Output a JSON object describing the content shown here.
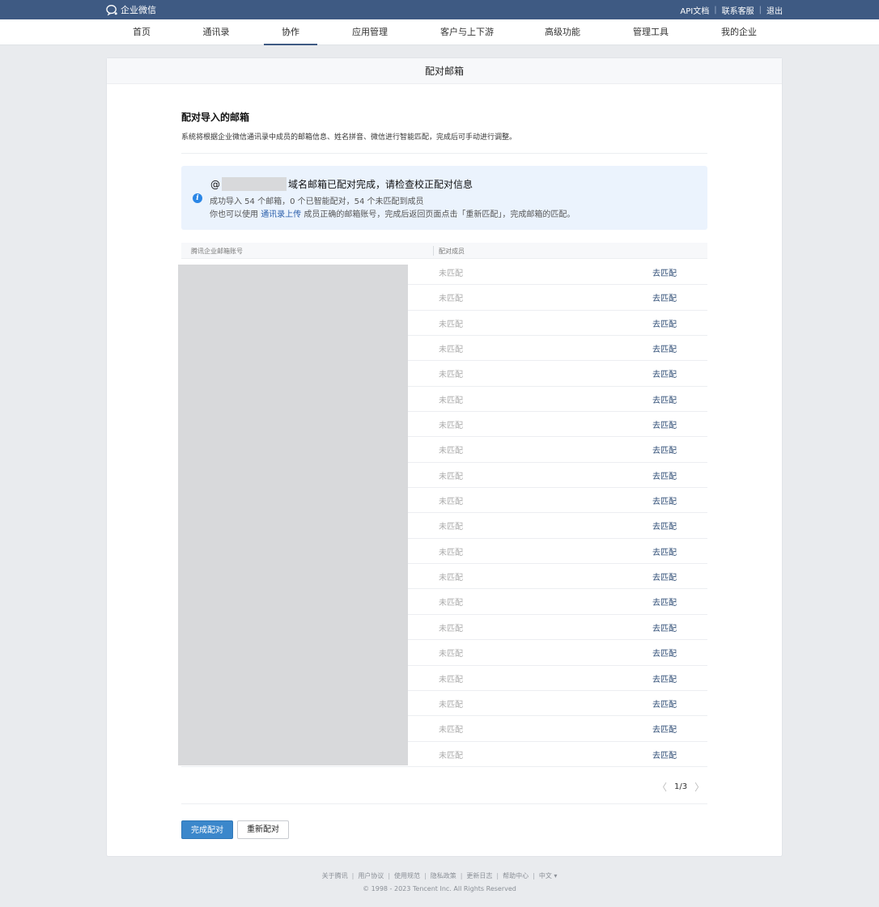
{
  "topbar": {
    "brand": "企业微信",
    "links": [
      "API文档",
      "联系客服",
      "退出"
    ]
  },
  "nav": {
    "items": [
      {
        "label": "首页"
      },
      {
        "label": "通讯录"
      },
      {
        "label": "协作",
        "active": true
      },
      {
        "label": "应用管理"
      },
      {
        "label": "客户与上下游"
      },
      {
        "label": "高级功能"
      },
      {
        "label": "管理工具"
      },
      {
        "label": "我的企业"
      }
    ]
  },
  "card": {
    "header": "配对邮箱",
    "section_title": "配对导入的邮箱",
    "section_desc": "系统将根据企业微信通讯录中成员的邮箱信息、姓名拼音、微信进行智能匹配，完成后可手动进行调整。"
  },
  "notice": {
    "at_prefix": "@",
    "title": "域名邮箱已配对完成，请检查校正配对信息",
    "line1": "成功导入 54 个邮箱，0 个已智能配对，54 个未匹配到成员",
    "line2_prefix": "你也可以使用",
    "line2_link": "通讯录上传",
    "line2_suffix": "成员正确的邮箱账号，完成后返回页面点击「重新匹配」，完成邮箱的匹配。"
  },
  "table": {
    "col1": "腾讯企业邮箱账号",
    "col2": "配对成员",
    "row_status": "未匹配",
    "row_action": "去匹配",
    "row_count": 20
  },
  "pager": {
    "page": "1/3",
    "prev": "〈",
    "next": "〉"
  },
  "buttons": {
    "finish": "完成配对",
    "rematch": "重新配对"
  },
  "footer": {
    "links": [
      "关于腾讯",
      "用户协议",
      "使用规范",
      "隐私政策",
      "更新日志",
      "帮助中心",
      "中文 ▾"
    ],
    "copyright": "© 1998 - 2023 Tencent Inc. All Rights Reserved"
  }
}
